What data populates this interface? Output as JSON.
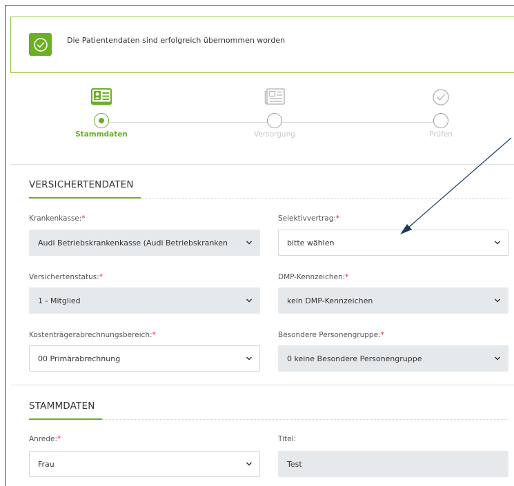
{
  "alert": {
    "message": "Die Patientendaten sind erfolgreich übernommen worden"
  },
  "steps": [
    {
      "label": "Stammdaten",
      "icon": "id-card-icon",
      "active": true
    },
    {
      "label": "Versorgung",
      "icon": "newspaper-icon",
      "active": false
    },
    {
      "label": "Prüfen",
      "icon": "check-circle-icon",
      "active": false
    }
  ],
  "versichertendaten": {
    "title": "VERSICHERTENDATEN",
    "krankenkasse": {
      "label": "Krankenkasse:",
      "value": "Audi Betriebskrankenkasse (Audi Betriebskranken"
    },
    "selektivvertrag": {
      "label": "Selektivvertrag:",
      "value": "bitte wählen"
    },
    "versichertenstatus": {
      "label": "Versichertenstatus:",
      "value": "1 - Mitglied"
    },
    "dmp": {
      "label": "DMP-Kennzeichen:",
      "value": "kein DMP-Kennzeichen"
    },
    "kostentraeger": {
      "label": "Kostenträgerabrechnungsbereich:",
      "value": "00 Primärabrechnung"
    },
    "personengruppe": {
      "label": "Besondere Personengruppe:",
      "value": "0 keine Besondere Personengruppe"
    }
  },
  "stammdaten": {
    "title": "STAMMDATEN",
    "anrede": {
      "label": "Anrede:",
      "value": "Frau"
    },
    "titel": {
      "label": "Titel:",
      "value": "Test"
    }
  },
  "required_marker": "*",
  "colors": {
    "accent": "#6ab023",
    "required": "#e0262d",
    "arrow": "#1b3a5c"
  }
}
